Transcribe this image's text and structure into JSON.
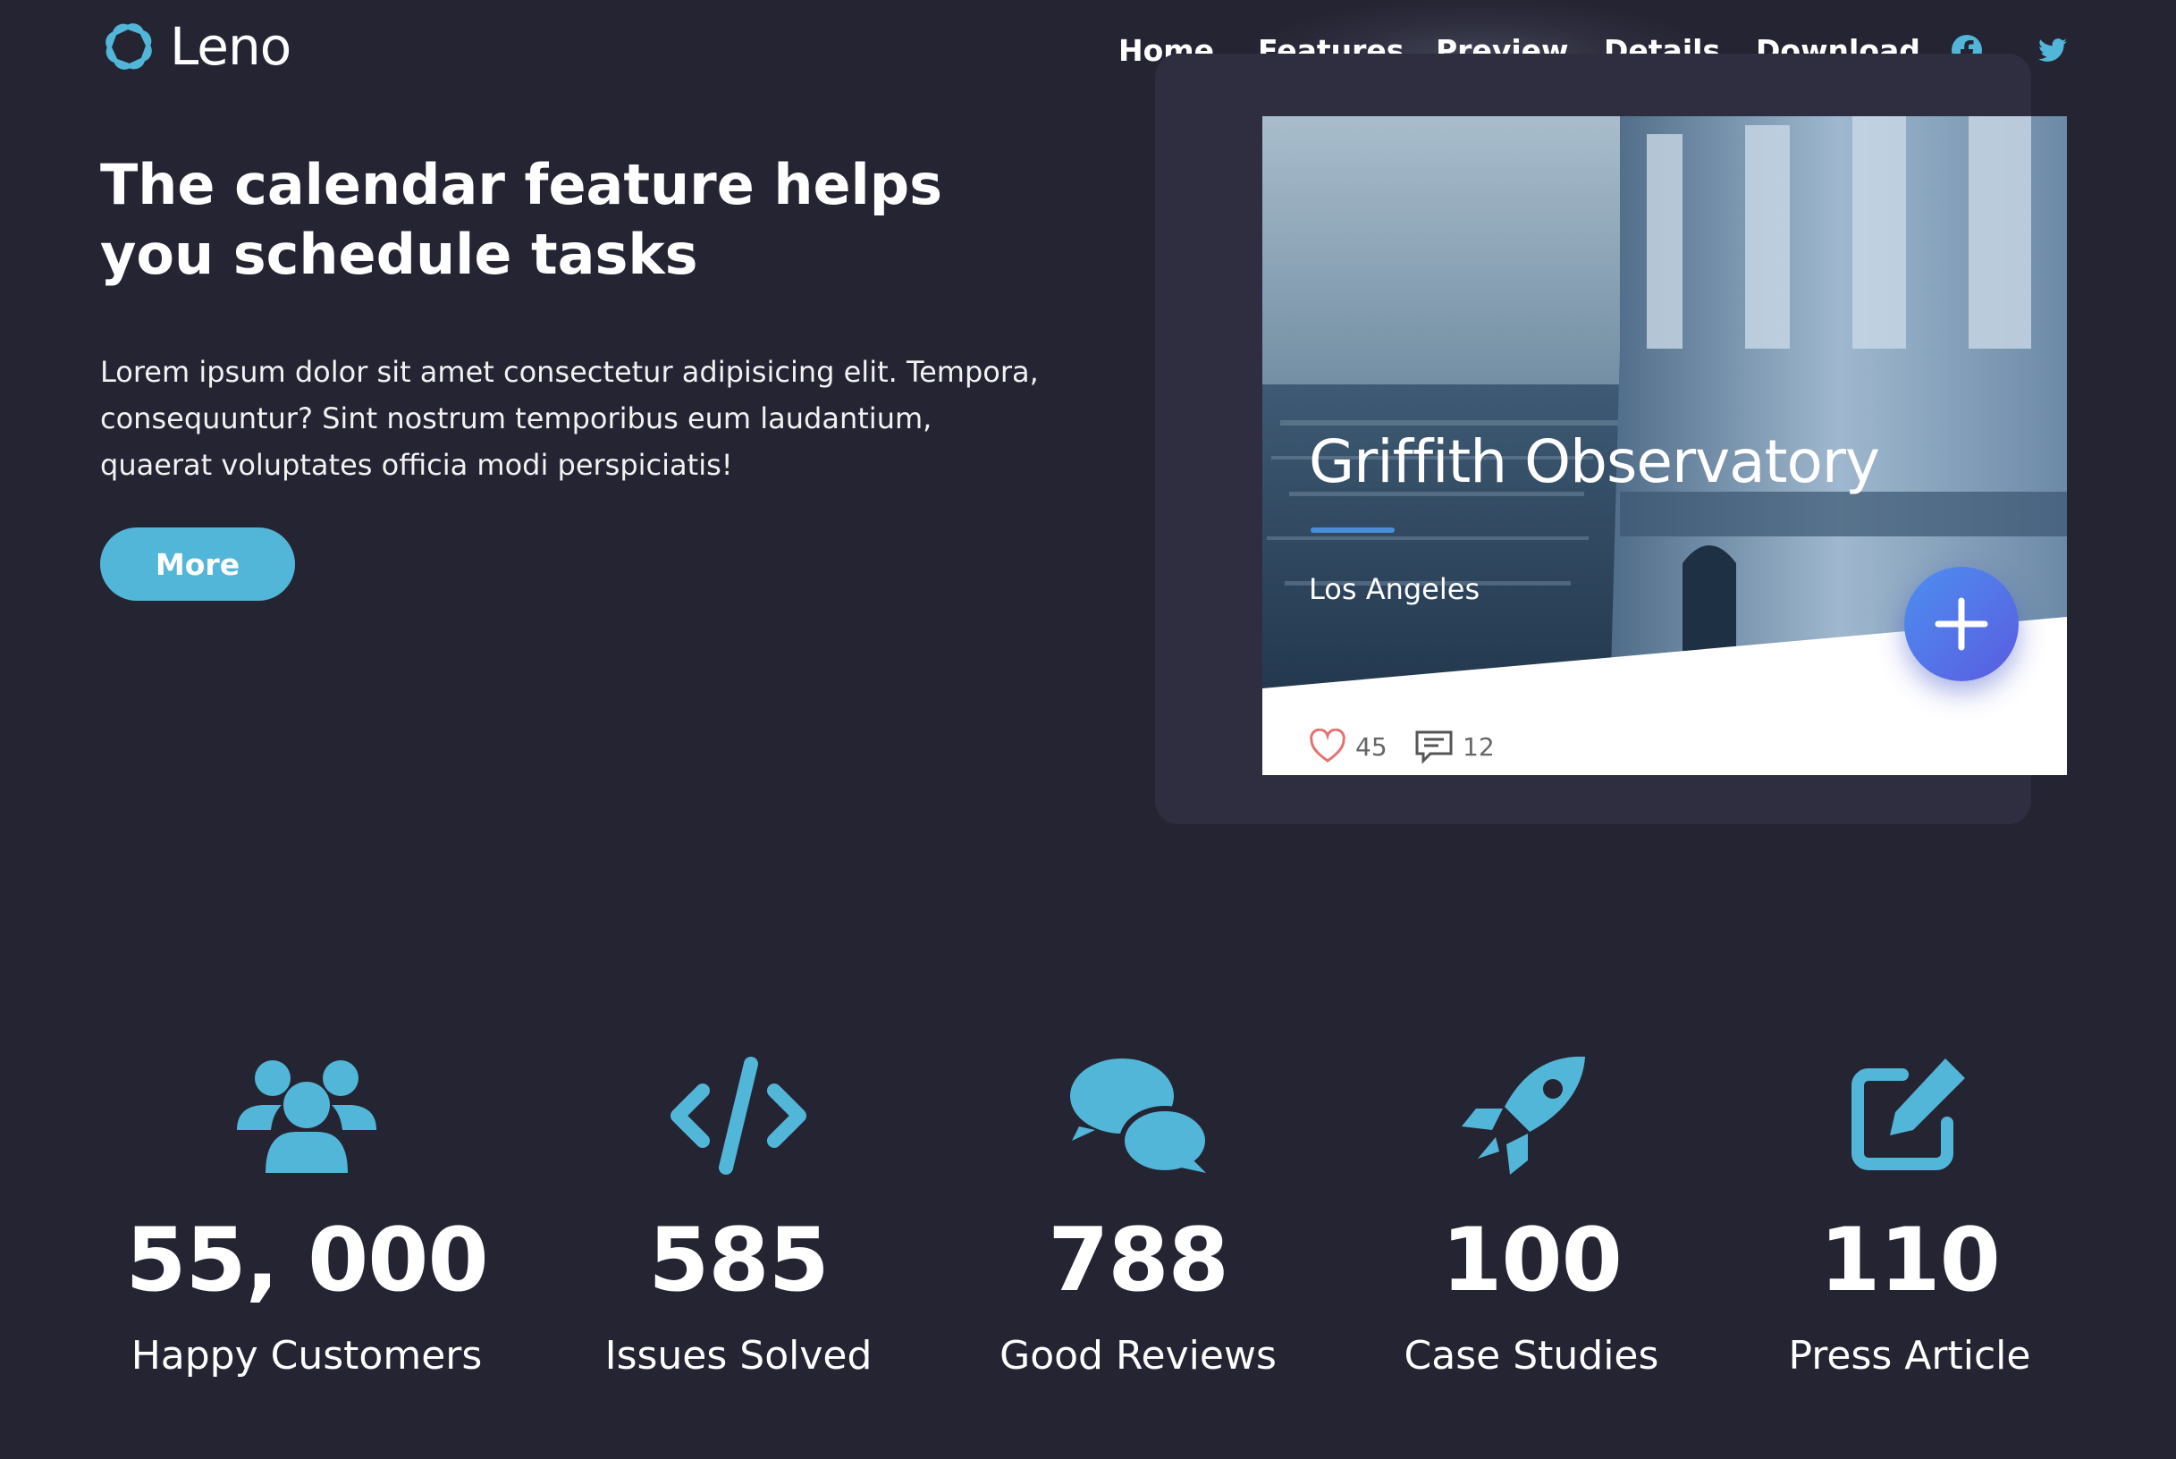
{
  "brand": {
    "name": "Leno",
    "accent": "#52b6d8"
  },
  "nav": {
    "items": [
      "Home",
      "Features",
      "Preview",
      "Details",
      "Download"
    ],
    "social": [
      "facebook-icon",
      "twitter-icon"
    ]
  },
  "hero": {
    "title": "The calendar feature helps you schedule tasks",
    "text": "Lorem ipsum dolor sit amet consectetur adipisicing elit. Tempora, consequuntur? Sint nostrum temporibus eum laudantium, quaerat voluptates officia modi perspiciatis!",
    "button": "More"
  },
  "card": {
    "title": "Griffith Observatory",
    "subtitle": "Los Angeles",
    "likes": "45",
    "comments": "12"
  },
  "stats": [
    {
      "icon": "users-icon",
      "value": "55, 000",
      "label": "Happy Customers"
    },
    {
      "icon": "code-icon",
      "value": "585",
      "label": "Issues Solved"
    },
    {
      "icon": "comments-icon",
      "value": "788",
      "label": "Good Reviews"
    },
    {
      "icon": "rocket-icon",
      "value": "100",
      "label": "Case Studies"
    },
    {
      "icon": "edit-icon",
      "value": "110",
      "label": "Press Article"
    }
  ]
}
